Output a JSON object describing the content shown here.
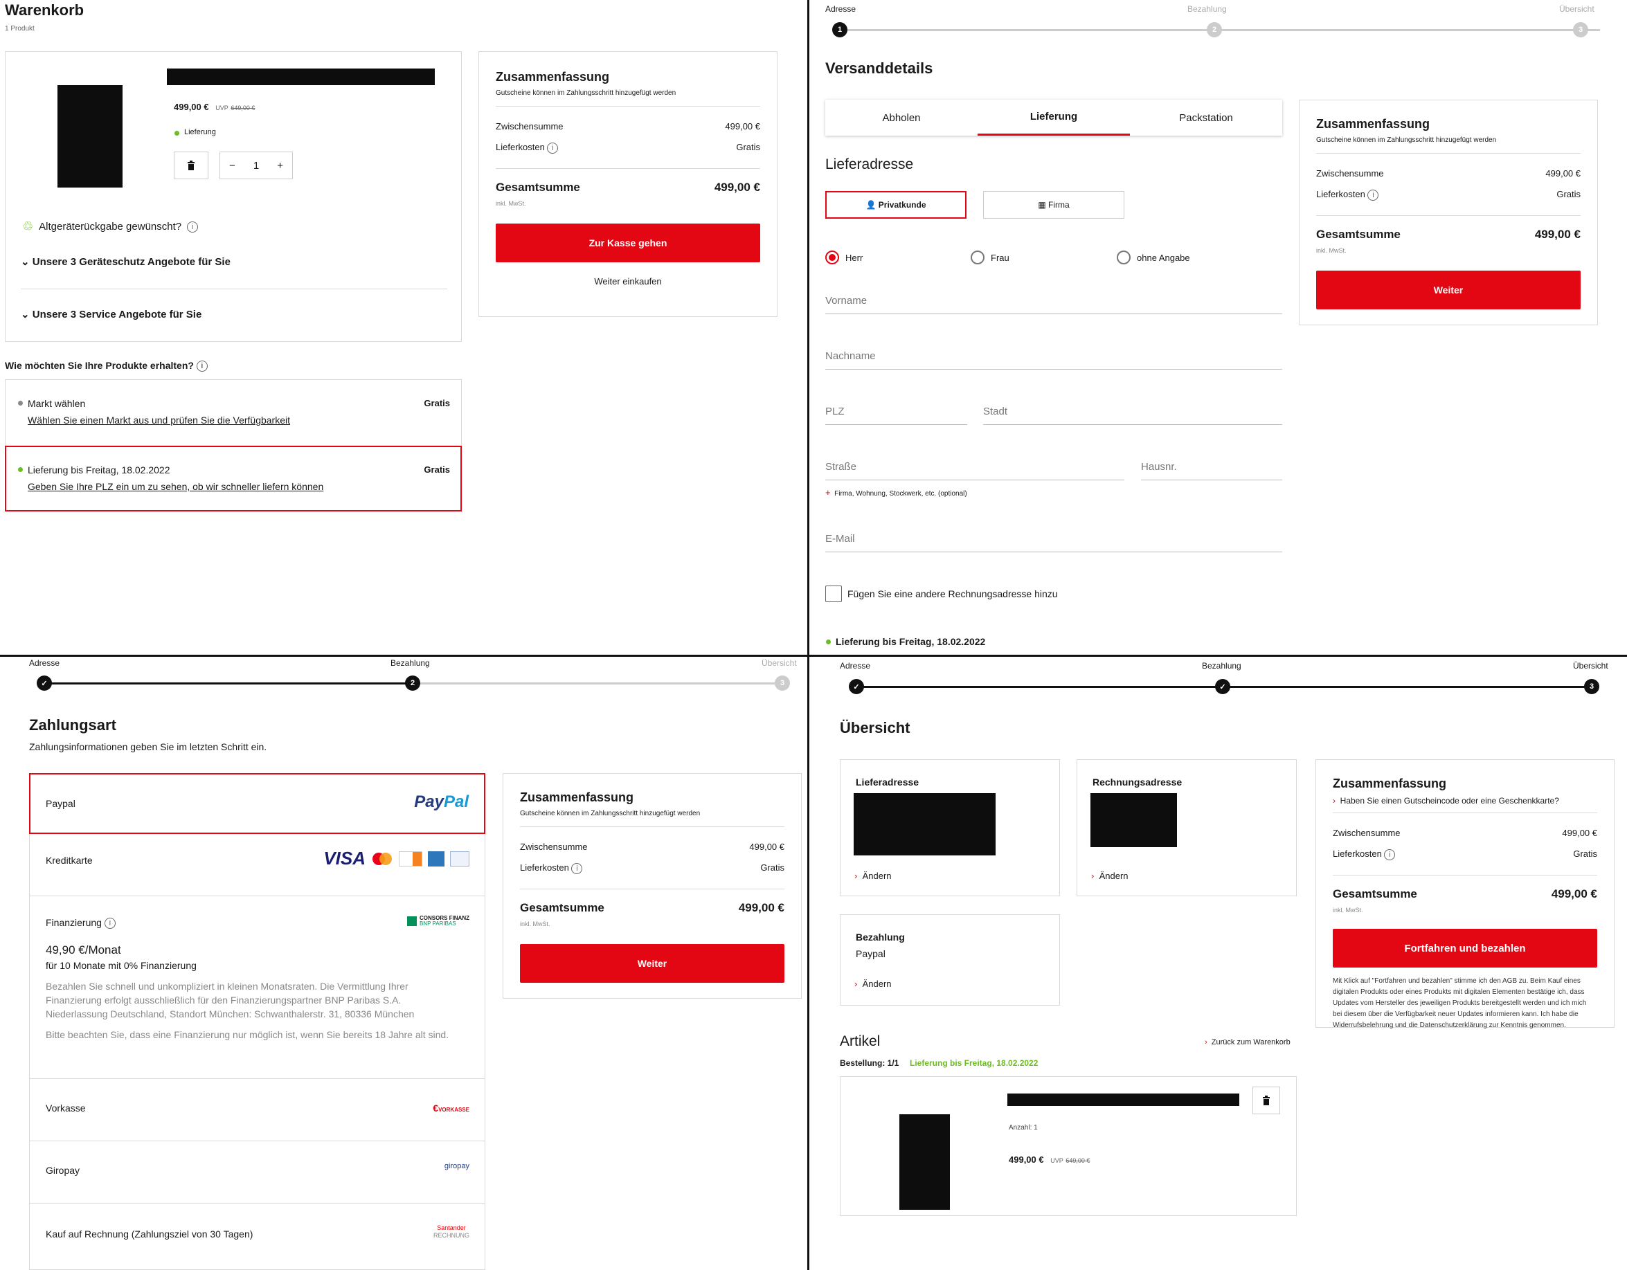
{
  "colors": {
    "accent": "#e30613",
    "success": "#6cbe1e",
    "text": "#1a1a1a",
    "muted": "#777777"
  },
  "summary": {
    "title": "Zusammenfassung",
    "voucher_note": "Gutscheine können im Zahlungsschritt hinzugefügt werden",
    "subtotal_label": "Zwischensumme",
    "subtotal": "499,00 €",
    "shipping_label": "Lieferkosten",
    "shipping": "Gratis",
    "total_label": "Gesamtsumme",
    "total": "499,00 €",
    "vat": "inkl. MwSt.",
    "next": "Weiter"
  },
  "cart": {
    "title": "Warenkorb",
    "count": "1 Produkt",
    "price": "499,00 €",
    "uvp_label": "UVP",
    "uvp": "649,00 €",
    "delivery_tag": "Lieferung",
    "qty": "1",
    "recycle": "Altgeräterückgabe gewünscht?",
    "protect": "Unsere 3 Geräteschutz Angebote für Sie",
    "service": "Unsere 3 Service Angebote für Sie",
    "checkout": "Zur Kasse gehen",
    "continue": "Weiter einkaufen",
    "how_q": "Wie möchten Sie Ihre Produkte erhalten?",
    "market_title": "Markt wählen",
    "market_link": "Wählen Sie einen Markt aus und prüfen Sie die Verfügbarkeit",
    "market_price": "Gratis",
    "deliv_title": "Lieferung bis Freitag, 18.02.2022",
    "deliv_link": "Geben Sie Ihre PLZ ein um zu sehen, ob wir schneller liefern können",
    "deliv_price": "Gratis"
  },
  "steps": {
    "s1": "Adresse",
    "s2": "Bezahlung",
    "s3": "Übersicht",
    "n1": "1",
    "n2": "2",
    "n3": "3"
  },
  "shipping": {
    "title": "Versanddetails",
    "tabs": [
      "Abholen",
      "Lieferung",
      "Packstation"
    ],
    "addr_title": "Lieferadresse",
    "private": "Privatkunde",
    "company": "Firma",
    "sal_herr": "Herr",
    "sal_frau": "Frau",
    "sal_none": "ohne Angabe",
    "first": "Vorname",
    "last": "Nachname",
    "zip": "PLZ",
    "city": "Stadt",
    "street": "Straße",
    "house": "Hausnr.",
    "extra": "Firma, Wohnung, Stockwerk, etc. (optional)",
    "email": "E-Mail",
    "billing": "Fügen Sie eine andere Rechnungsadresse hinzu",
    "delivery": "Lieferung bis Freitag, 18.02.2022"
  },
  "payment": {
    "title": "Zahlungsart",
    "subtitle": "Zahlungsinformationen geben Sie im letzten Schritt ein.",
    "paypal": "Paypal",
    "card": "Kreditkarte",
    "fin": "Finanzierung",
    "fin_rate": "49,90 €/Monat",
    "fin_terms": "für 10 Monate mit 0% Finanzierung",
    "fin_desc": "Bezahlen Sie schnell und unkompliziert in kleinen Monatsraten. Die Vermittlung Ihrer Finanzierung erfolgt ausschließlich für den Finanzierungspartner BNP Paribas S.A. Niederlassung Deutschland, Standort München: Schwanthalerstr. 31, 80336 München",
    "fin_note": "Bitte beachten Sie, dass eine Finanzierung nur möglich ist, wenn Sie bereits 18 Jahre alt sind.",
    "prepay": "Vorkasse",
    "giro": "Giropay",
    "invoice": "Kauf auf Rechnung (Zahlungsziel von 30 Tagen)",
    "logo_paypal_a": "Pay",
    "logo_paypal_b": "Pal",
    "logo_visa": "VISA",
    "logo_consors": "CONSORS FINANZ",
    "logo_consors_sub": "BNP PARIBAS",
    "logo_vorkasse": "VORKASSE",
    "logo_giro": "giropay",
    "logo_santander": "Santander",
    "logo_rechnung": "RECHNUNG"
  },
  "overview": {
    "title": "Übersicht",
    "ship_addr": "Lieferadresse",
    "bill_addr": "Rechnungsadresse",
    "change": "Ändern",
    "pay": "Bezahlung",
    "pay_val": "Paypal",
    "voucher_q": "Haben Sie einen Gutscheincode oder eine Geschenkkarte?",
    "pay_btn": "Fortfahren und bezahlen",
    "legal": "Mit Klick auf \"Fortfahren und bezahlen\" stimme ich den AGB zu. Beim Kauf eines digitalen Produkts oder eines Produkts mit digitalen Elementen bestätige ich, dass Updates vom Hersteller des jeweiligen Produkts bereitgestellt werden und ich mich bei diesem über die Verfügbarkeit neuer Updates informieren kann. Ich habe die Widerrufsbelehrung und die Datenschutzerklärung zur Kenntnis genommen.",
    "articles": "Artikel",
    "back": "Zurück zum Warenkorb",
    "order": "Bestellung: 1/1",
    "delivery": "Lieferung bis Freitag, 18.02.2022",
    "qty": "Anzahl: 1",
    "price": "499,00 €",
    "uvp_label": "UVP",
    "uvp": "649,00 €"
  }
}
